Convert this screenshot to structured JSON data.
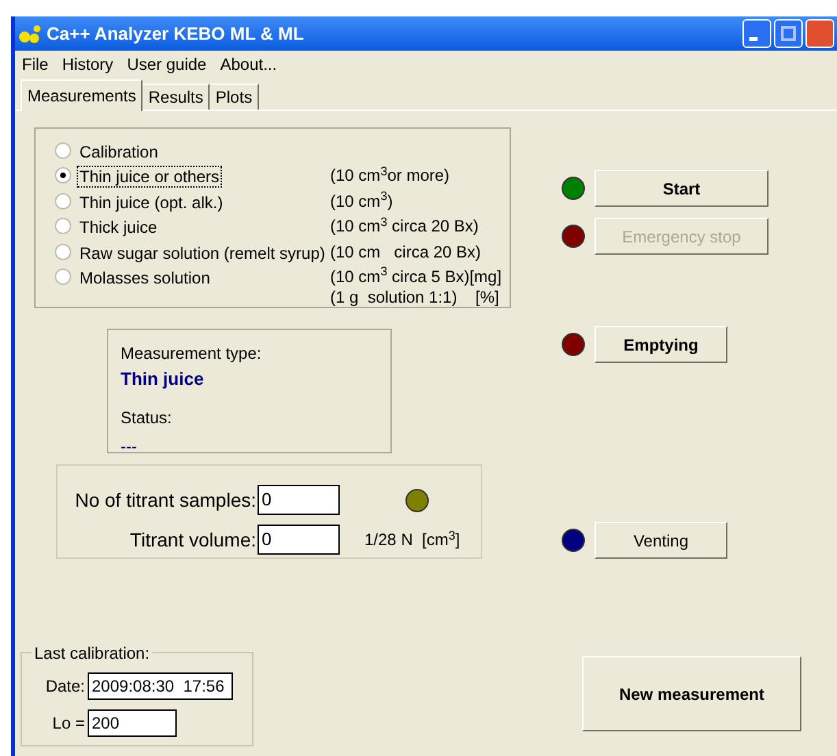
{
  "window": {
    "title": "Ca++ Analyzer KEBO ML & ML"
  },
  "menu": [
    {
      "label": "File"
    },
    {
      "label": "History"
    },
    {
      "label": "User guide"
    },
    {
      "label": "About..."
    }
  ],
  "tabs": [
    {
      "label": "Measurements",
      "selected": true
    },
    {
      "label": "Results",
      "selected": false
    },
    {
      "label": "Plots",
      "selected": false
    }
  ],
  "measurement_types": [
    {
      "label": "Calibration",
      "selected": false
    },
    {
      "label": "Thin juice or others",
      "selected": true,
      "note": [
        "(10 cm$^{3}$or more)"
      ]
    },
    {
      "label": "Thin juice (opt. alk.)",
      "selected": false,
      "note": [
        "(10 cm$^{3}$)"
      ]
    },
    {
      "label": "Thick juice",
      "selected": false,
      "note": [
        "(10 cm$^{3}$ circa 20 Bx)"
      ]
    },
    {
      "label": "Raw sugar solution (remelt syrup)",
      "selected": false,
      "note": [
        "(10 cm   circa 20 Bx)"
      ]
    },
    {
      "label": "Molasses solution",
      "selected": false,
      "note": [
        "(10 cm$^{3}$ circa 5 Bx)[mg]",
        "(1 g  solution 1:1)    [%]"
      ]
    }
  ],
  "info": {
    "measurement_type_label": "Measurement type:",
    "measurement_type_value": "Thin juice",
    "status_label": "Status:",
    "status_value": "---"
  },
  "titrant": {
    "samples_label": "No of titrant samples:",
    "samples_value": "0",
    "indicator": {
      "color": "#808000"
    },
    "volume_label": "Titrant volume:",
    "volume_value": "0",
    "volume_unit": "1/28 N  [cm$^{3}$]"
  },
  "actions": [
    {
      "label": "Start",
      "color": "#008000",
      "disabled": false,
      "bold": true
    },
    {
      "label": "Emergency stop",
      "color": "#800000",
      "disabled": true,
      "bold": false
    },
    {
      "label": "Emptying",
      "color": "#800000",
      "disabled": false,
      "bold": true
    },
    {
      "label": "Venting",
      "color": "#000080",
      "disabled": false,
      "bold": false
    }
  ],
  "last_calibration": {
    "title": "Last calibration:",
    "date_label": "Date:",
    "date_value": "2009:08:30  17:56",
    "lo_label": "Lo =",
    "lo_value": "200"
  },
  "new_measurement_button": {
    "label": "New measurement"
  }
}
